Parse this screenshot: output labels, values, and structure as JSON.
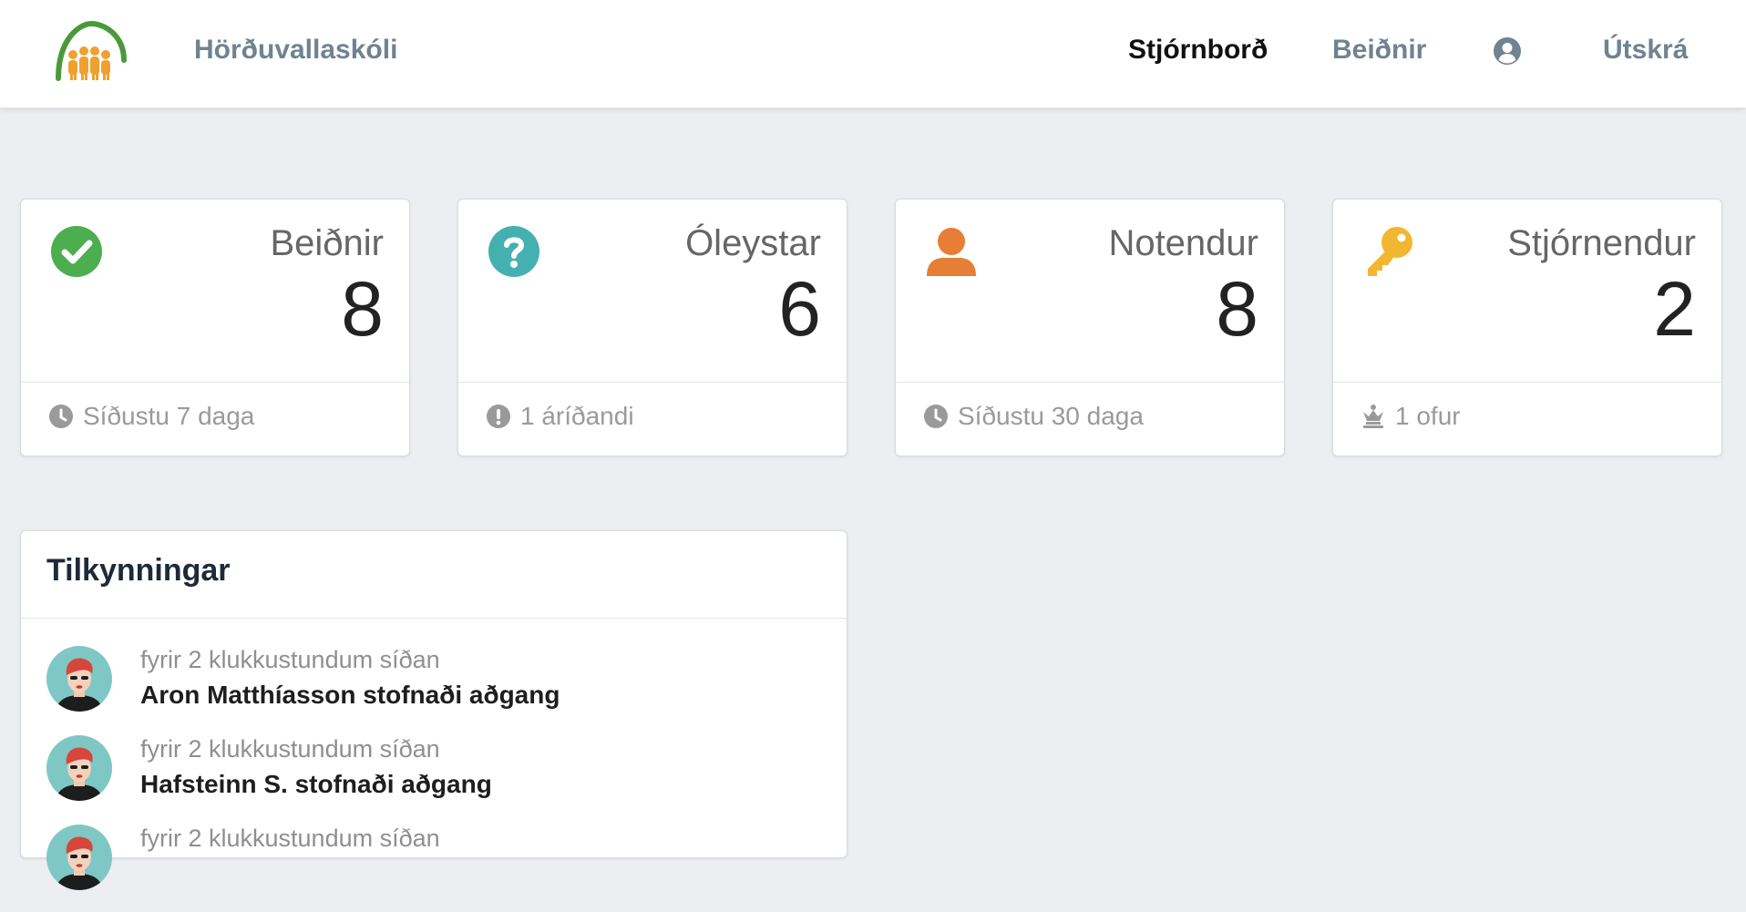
{
  "header": {
    "brand": "Hörðuvallaskóli",
    "nav": {
      "dashboard": "Stjórnborð",
      "requests": "Beiðnir",
      "logout": "Útskrá"
    }
  },
  "cards": [
    {
      "title": "Beiðnir",
      "value": "8",
      "footer": "Síðustu 7 daga",
      "icon": "check-circle-icon",
      "footer_icon": "clock-icon",
      "color": "#4cae4f"
    },
    {
      "title": "Óleystar",
      "value": "6",
      "footer": "1 áríðandi",
      "icon": "question-circle-icon",
      "footer_icon": "exclamation-circle-icon",
      "color": "#45b0b0"
    },
    {
      "title": "Notendur",
      "value": "8",
      "footer": "Síðustu 30 daga",
      "icon": "user-icon",
      "footer_icon": "clock-icon",
      "color": "#e67e35"
    },
    {
      "title": "Stjórnendur",
      "value": "2",
      "footer": "1 ofur",
      "icon": "key-icon",
      "footer_icon": "chess-queen-icon",
      "color": "#f2b630"
    }
  ],
  "notifications": {
    "title": "Tilkynningar",
    "items": [
      {
        "time": "fyrir 2 klukkustundum síðan",
        "text": "Aron Matthíasson stofnaði aðgang"
      },
      {
        "time": "fyrir 2 klukkustundum síðan",
        "text": "Hafsteinn S. stofnaði aðgang"
      },
      {
        "time": "fyrir 2 klukkustundum síðan",
        "text": ""
      }
    ]
  }
}
